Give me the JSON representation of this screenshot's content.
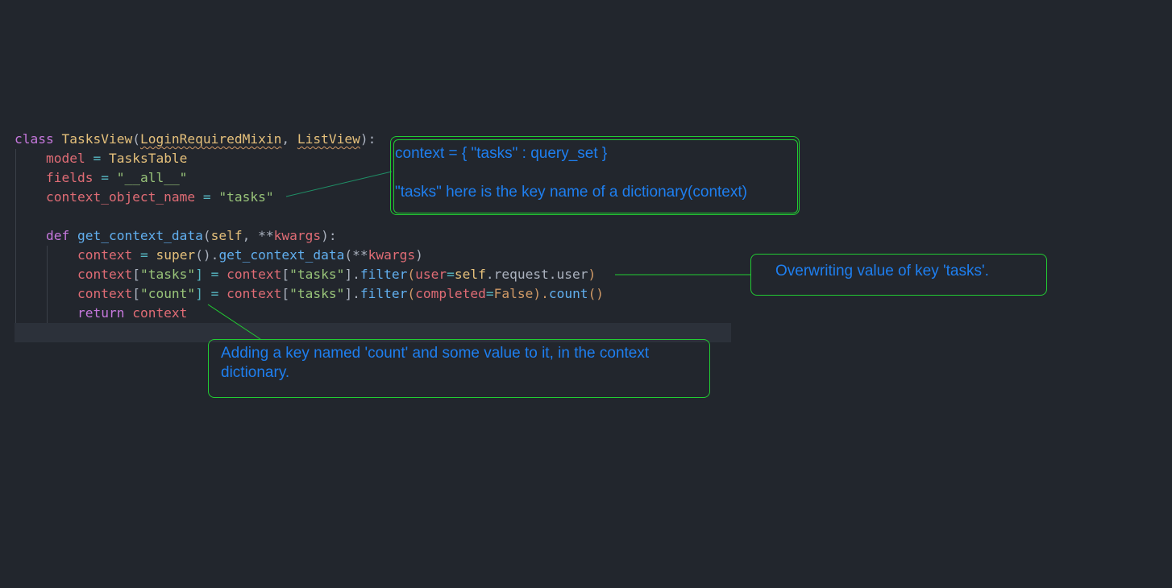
{
  "code": {
    "lines": [
      {
        "tokens": [
          {
            "t": "class ",
            "c": "kw"
          },
          {
            "t": "TasksView",
            "c": "cls"
          },
          {
            "t": "(",
            "c": "pl"
          },
          {
            "t": "LoginRequiredMixin",
            "c": "cls squig"
          },
          {
            "t": ", ",
            "c": "pl"
          },
          {
            "t": "ListView",
            "c": "cls squig"
          },
          {
            "t": "):",
            "c": "pl"
          }
        ]
      },
      {
        "tokens": [
          {
            "t": "    ",
            "c": "pl"
          },
          {
            "t": "model",
            "c": "var"
          },
          {
            "t": " = ",
            "c": "op"
          },
          {
            "t": "TasksTable",
            "c": "cls"
          }
        ]
      },
      {
        "tokens": [
          {
            "t": "    ",
            "c": "pl"
          },
          {
            "t": "fields",
            "c": "var"
          },
          {
            "t": " = ",
            "c": "op"
          },
          {
            "t": "\"__all__\"",
            "c": "str"
          }
        ]
      },
      {
        "tokens": [
          {
            "t": "    ",
            "c": "pl"
          },
          {
            "t": "context_object_name",
            "c": "var"
          },
          {
            "t": " = ",
            "c": "op"
          },
          {
            "t": "\"tasks\"",
            "c": "str"
          }
        ]
      },
      {
        "tokens": []
      },
      {
        "tokens": [
          {
            "t": "    ",
            "c": "pl"
          },
          {
            "t": "def ",
            "c": "kw"
          },
          {
            "t": "get_context_data",
            "c": "fn"
          },
          {
            "t": "(",
            "c": "pl"
          },
          {
            "t": "self",
            "c": "cls"
          },
          {
            "t": ", ",
            "c": "pl"
          },
          {
            "t": "**",
            "c": "pl"
          },
          {
            "t": "kwargs",
            "c": "var"
          },
          {
            "t": "):",
            "c": "pl"
          }
        ]
      },
      {
        "tokens": [
          {
            "t": "        ",
            "c": "pl"
          },
          {
            "t": "context",
            "c": "var"
          },
          {
            "t": " = ",
            "c": "op"
          },
          {
            "t": "super",
            "c": "cls"
          },
          {
            "t": "().",
            "c": "pl"
          },
          {
            "t": "get_context_data",
            "c": "fn"
          },
          {
            "t": "(",
            "c": "pl"
          },
          {
            "t": "**",
            "c": "pl"
          },
          {
            "t": "kwargs",
            "c": "var"
          },
          {
            "t": ")",
            "c": "pl"
          }
        ]
      },
      {
        "tokens": [
          {
            "t": "        ",
            "c": "pl"
          },
          {
            "t": "context",
            "c": "var"
          },
          {
            "t": "[",
            "c": "pl"
          },
          {
            "t": "\"tasks\"",
            "c": "str"
          },
          {
            "t": "] = ",
            "c": "op"
          },
          {
            "t": "context",
            "c": "var"
          },
          {
            "t": "[",
            "c": "pl"
          },
          {
            "t": "\"tasks\"",
            "c": "str"
          },
          {
            "t": "].",
            "c": "pl"
          },
          {
            "t": "filter",
            "c": "fn"
          },
          {
            "t": "(",
            "c": "num"
          },
          {
            "t": "user",
            "c": "var"
          },
          {
            "t": "=",
            "c": "op"
          },
          {
            "t": "self",
            "c": "cls"
          },
          {
            "t": ".request.user",
            "c": "pl"
          },
          {
            "t": ")",
            "c": "num"
          }
        ]
      },
      {
        "tokens": [
          {
            "t": "        ",
            "c": "pl"
          },
          {
            "t": "context",
            "c": "var"
          },
          {
            "t": "[",
            "c": "pl"
          },
          {
            "t": "\"count\"",
            "c": "str"
          },
          {
            "t": "] = ",
            "c": "op"
          },
          {
            "t": "context",
            "c": "var"
          },
          {
            "t": "[",
            "c": "pl"
          },
          {
            "t": "\"tasks\"",
            "c": "str"
          },
          {
            "t": "].",
            "c": "pl"
          },
          {
            "t": "filter",
            "c": "fn"
          },
          {
            "t": "(",
            "c": "num"
          },
          {
            "t": "completed",
            "c": "var"
          },
          {
            "t": "=",
            "c": "op"
          },
          {
            "t": "False",
            "c": "num"
          },
          {
            "t": ").",
            "c": "num"
          },
          {
            "t": "count",
            "c": "fn"
          },
          {
            "t": "()",
            "c": "num"
          }
        ]
      },
      {
        "tokens": [
          {
            "t": "        ",
            "c": "pl"
          },
          {
            "t": "return ",
            "c": "kw"
          },
          {
            "t": "context",
            "c": "var"
          }
        ]
      },
      {
        "tokens": []
      }
    ]
  },
  "annotations": {
    "context_note": {
      "line1": "context = { \"tasks\" : query_set }",
      "line2": "\"tasks\" here is the key name of a dictionary(context)"
    },
    "overwrite_note": {
      "text": "Overwriting value of key 'tasks'."
    },
    "count_note": {
      "line1": "Adding a key named 'count' and some value to it, in the context",
      "line2": "dictionary."
    }
  },
  "colors": {
    "background": "#22262d",
    "annotation_border": "#22cc33",
    "annotation_text": "#1e7ff0"
  }
}
